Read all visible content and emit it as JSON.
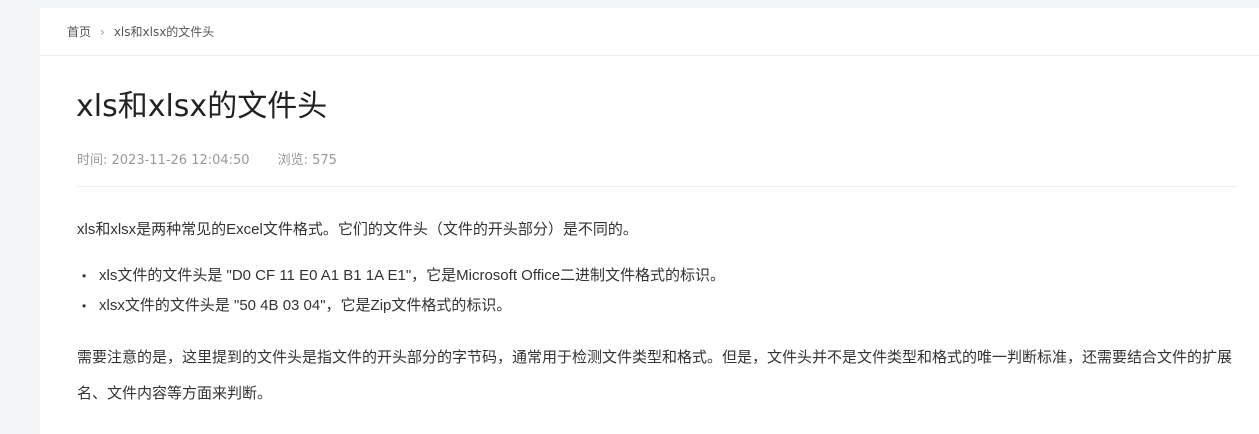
{
  "breadcrumb": {
    "home": "首页",
    "separator": "›",
    "current": "xls和xlsx的文件头"
  },
  "article": {
    "title": "xls和xlsx的文件头",
    "time": "时间: 2023-11-26 12:04:50",
    "views": "浏览: 575",
    "intro": "xls和xlsx是两种常见的Excel文件格式。它们的文件头（文件的开头部分）是不同的。",
    "bullets": [
      "xls文件的文件头是 \"D0 CF 11 E0 A1 B1 1A E1\"，它是Microsoft Office二进制文件格式的标识。",
      "xlsx文件的文件头是 \"50 4B 03 04\"，它是Zip文件格式的标识。"
    ],
    "bullet_symbol": "•",
    "note": "需要注意的是，这里提到的文件头是指文件的开头部分的字节码，通常用于检测文件类型和格式。但是，文件头并不是文件类型和格式的唯一判断标准，还需要结合文件的扩展名、文件内容等方面来判断。"
  }
}
